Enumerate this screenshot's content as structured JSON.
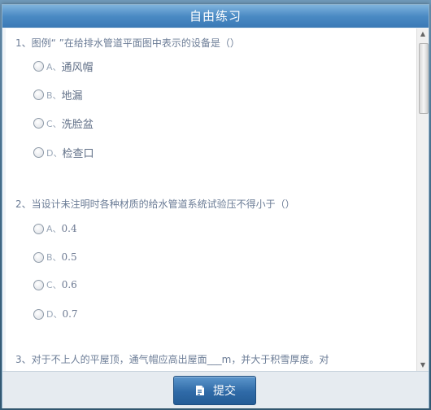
{
  "dialog": {
    "title": "自由练习"
  },
  "questions": [
    {
      "stem": "1、图例“ ”在给排水管道平面图中表示的设备是（）",
      "options": [
        {
          "letter": "A、",
          "text": "通风帽"
        },
        {
          "letter": "B、",
          "text": "地漏"
        },
        {
          "letter": "C、",
          "text": "洗脸盆"
        },
        {
          "letter": "D、",
          "text": "检查口"
        }
      ]
    },
    {
      "stem": "2、当设计未注明时各种材质的给水管道系统试验压不得小于（）",
      "options": [
        {
          "letter": "A、",
          "text": "0.4"
        },
        {
          "letter": "B、",
          "text": "0.5"
        },
        {
          "letter": "C、",
          "text": "0.6"
        },
        {
          "letter": "D、",
          "text": "0.7"
        }
      ]
    },
    {
      "stem": "3、对于不上人的平屋顶，通气帽应高出屋面___m，并大于积雪厚度。对"
    }
  ],
  "footer": {
    "submit_label": "提交"
  }
}
